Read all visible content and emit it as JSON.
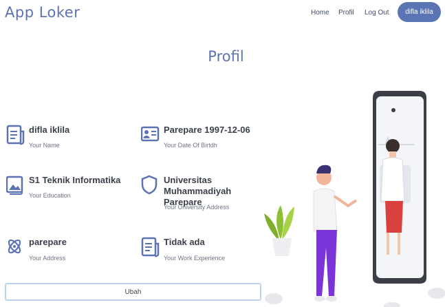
{
  "header": {
    "brand": "App Loker",
    "nav": {
      "home": "Home",
      "profil": "Profil",
      "logout": "Log Out"
    },
    "user_button": "difla iklila"
  },
  "page": {
    "title": "Profil"
  },
  "profile": {
    "name": {
      "value": "difla iklila",
      "label": "Your Name"
    },
    "birth": {
      "value": "Parepare 1997-12-06",
      "label": "Your Date Of Birtdh"
    },
    "education": {
      "value": "S1 Teknik Informatika",
      "label": "Your Education"
    },
    "university": {
      "value": "Universitas Muhammadiyah Parepare",
      "label": "Your University Address"
    },
    "address": {
      "value": "parepare",
      "label": "Your Address"
    },
    "experience": {
      "value": "Tidak ada",
      "label": "Your Work Experience"
    }
  },
  "actions": {
    "edit_label": "Ubah"
  },
  "theme": {
    "accent": "#5a74b4",
    "icon_color": "#5b73b1"
  }
}
